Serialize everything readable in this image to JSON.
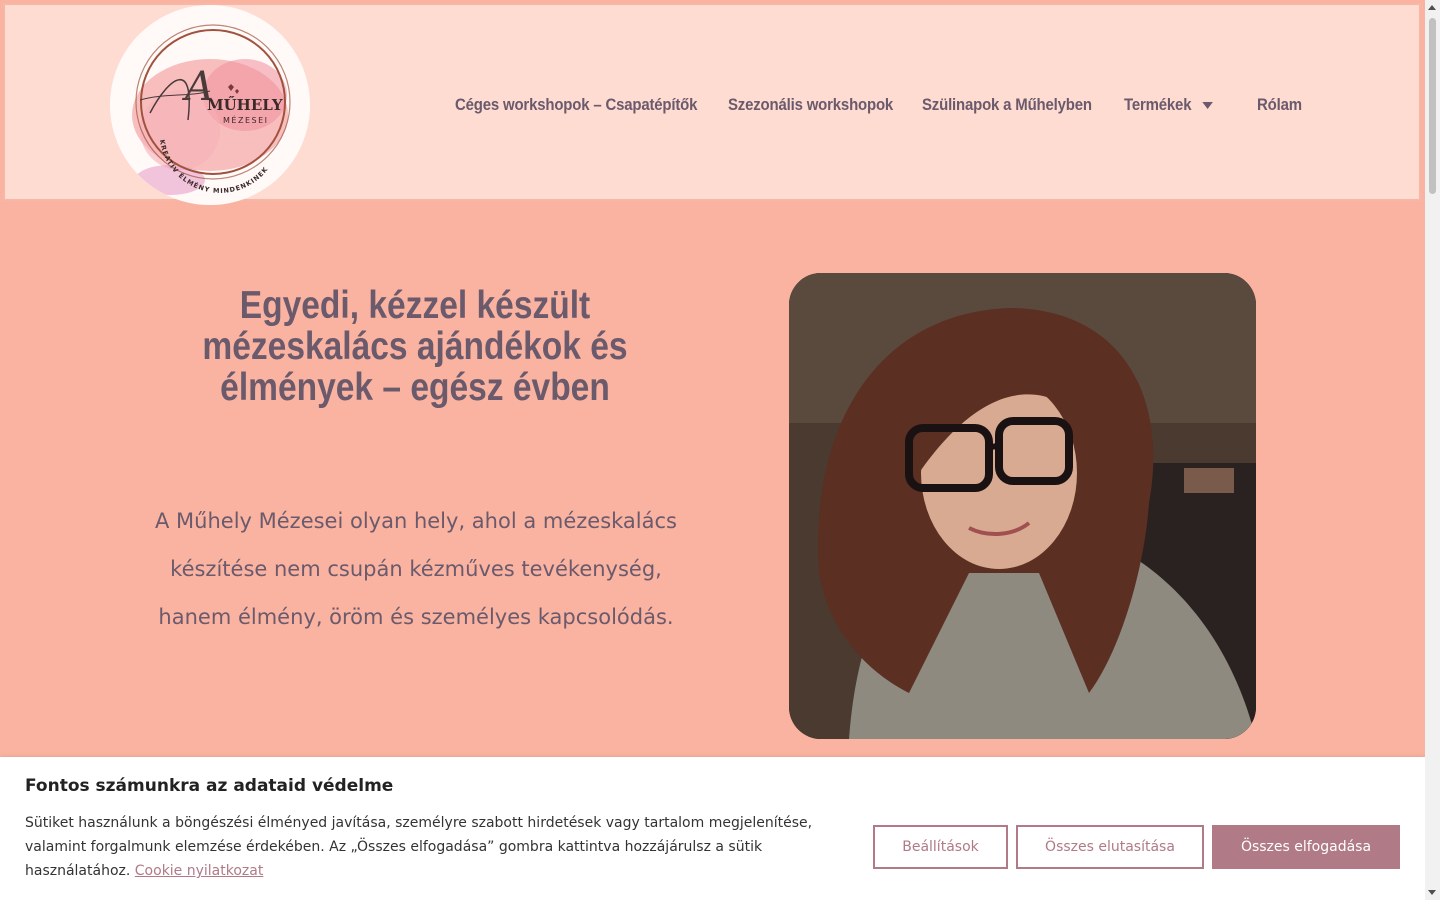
{
  "brand": {
    "logo_line1": "A",
    "logo_line2": "MŰHELY",
    "logo_line3": "MÉZESEI",
    "logo_ring_text": "KREATÍV ÉLMÉNY MINDENKINEK"
  },
  "nav": {
    "items": [
      {
        "label": "Céges workshopok – Csapatépítők"
      },
      {
        "label": "Szezonális workshopok"
      },
      {
        "label": "Szülinapok a Műhelyben"
      },
      {
        "label": "Termékek"
      },
      {
        "label": "Rólam"
      }
    ]
  },
  "hero": {
    "title": "Egyedi, kézzel készült mézeskalács ajándékok és élmények – egész évben",
    "text": "A Műhely Mézesei olyan hely, ahol a mézeskalács készítése nem csupán kézműves tevékenység, hanem élmény, öröm és személyes kapcsolódás."
  },
  "cookie": {
    "title": "Fontos számunkra az adataid védelme",
    "text": "Sütiket használunk a böngészési élményed javítása, személyre szabott hirdetések vagy tartalom megjelenítése, valamint forgalmunk elemzése érdekében. Az „Összes elfogadása” gombra kattintva hozzájárulsz a sütik használatához.",
    "link": "Cookie nyilatkozat",
    "settings": "Beállítások",
    "reject": "Összes elutasítása",
    "accept": "Összes elfogadása"
  },
  "colors": {
    "page_bg": "#f9b3a0",
    "header_bg": "#fedcd2",
    "text": "#6b5a6c",
    "accent": "#b07a86"
  }
}
